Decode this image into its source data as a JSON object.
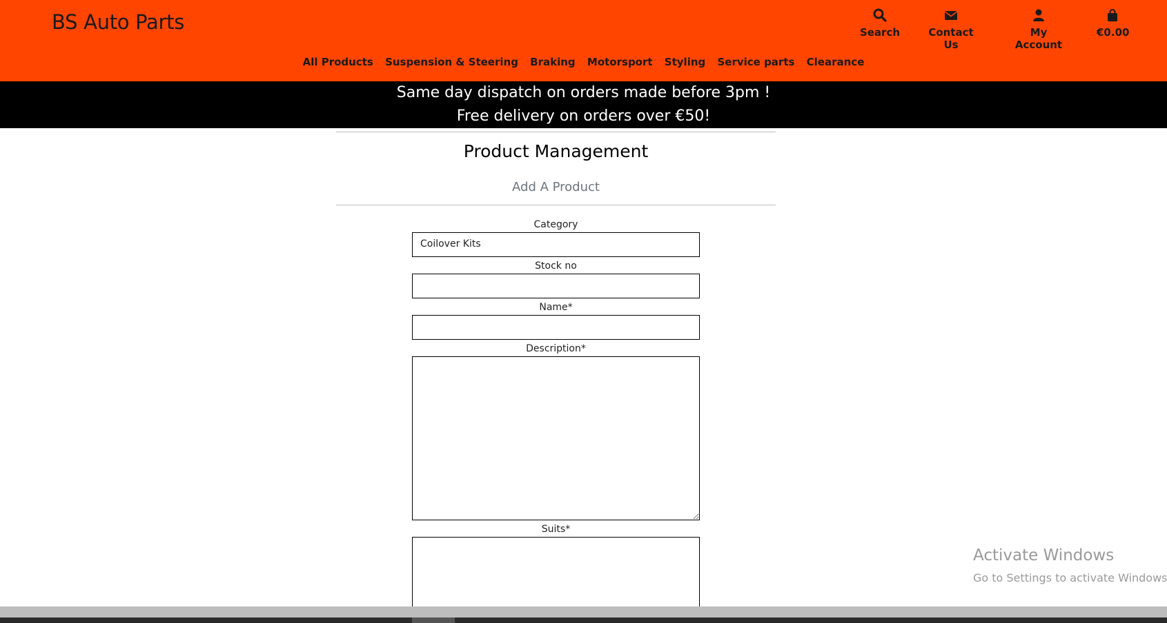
{
  "header": {
    "brand": "BS Auto Parts",
    "actions": [
      {
        "label": "Search",
        "icon": "search-icon"
      },
      {
        "label": "Contact Us",
        "icon": "envelope-icon"
      },
      {
        "label": "My Account",
        "icon": "user-icon"
      },
      {
        "label": "€0.00",
        "icon": "shopping-bag-icon"
      }
    ],
    "nav": [
      "All Products",
      "Suspension & Steering",
      "Braking",
      "Motorsport",
      "Styling",
      "Service parts",
      "Clearance"
    ],
    "background_color": "#ff4500"
  },
  "banner": {
    "line1": "Same day dispatch on orders made before 3pm !",
    "line2": "Free delivery on orders over €50!"
  },
  "page": {
    "title": "Product Management",
    "subtitle": "Add A Product"
  },
  "form": {
    "category_label": "Category",
    "category_value": "Coilover Kits",
    "stock_label": "Stock no",
    "stock_value": "",
    "name_label": "Name*",
    "name_value": "",
    "description_label": "Description*",
    "description_value": "",
    "suits_label": "Suits*",
    "suits_value": ""
  },
  "watermark": {
    "title": "Activate Windows",
    "subtitle": "Go to Settings to activate Windows."
  }
}
